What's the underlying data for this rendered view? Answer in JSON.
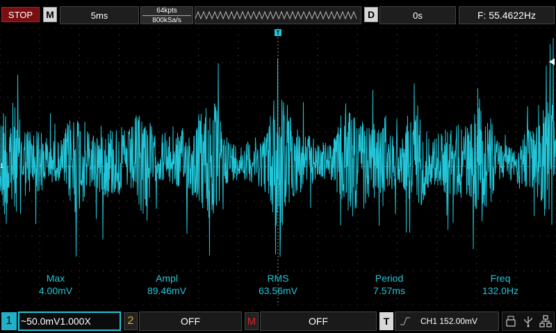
{
  "top_bar": {
    "run_state": "STOP",
    "mode_key": "M",
    "timebase": "5ms",
    "memory_depth": "64kpts",
    "sample_rate": "800kSa/s",
    "delay_key": "D",
    "delay": "0s",
    "frequency_counter": "F: 55.4622Hz"
  },
  "screen": {
    "ch1_marker": "1",
    "trigger_marker": "T",
    "waveform_color": "#22c6d8",
    "grid_color": "#4a4a4a"
  },
  "measurements": [
    {
      "label": "Max",
      "value": "4.00mV"
    },
    {
      "label": "Ampl",
      "value": "89.46mV"
    },
    {
      "label": "RMS",
      "value": "63.56mV"
    },
    {
      "label": "Period",
      "value": "7.57ms"
    },
    {
      "label": "Freq",
      "value": "132.0Hz"
    }
  ],
  "bottom_bar": {
    "ch1_number": "1",
    "ch1_settings": "~50.0mV1.000X",
    "ch2_number": "2",
    "ch2_state": "OFF",
    "math_key": "M",
    "math_state": "OFF",
    "trigger_key": "T",
    "trigger_edge_icon": "rising-edge-icon",
    "trigger_setting": "CH1 152.00mV",
    "status_icons": [
      "usb-drive-icon",
      "usb-icon",
      "network-icon"
    ]
  }
}
